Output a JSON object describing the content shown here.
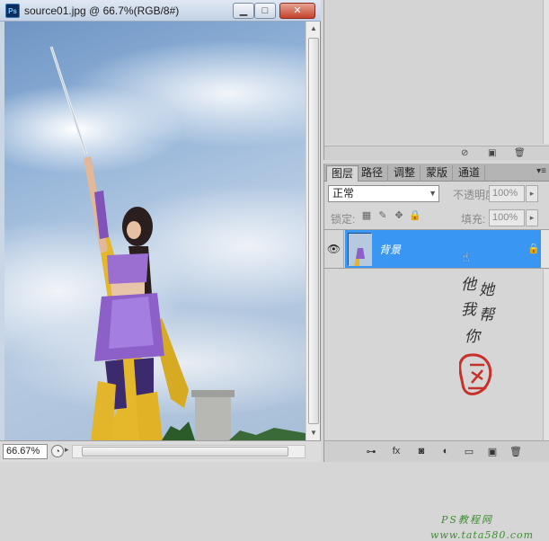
{
  "document": {
    "title": "source01.jpg @ 66.7%(RGB/8#)",
    "zoom": "66.67%",
    "ps_icon": "Ps"
  },
  "window_buttons": {
    "minimize": "▁",
    "maximize": "□",
    "close": "✕"
  },
  "top_panel": {
    "footer_icons": [
      "no-icon",
      "new-icon",
      "trash-icon"
    ]
  },
  "layers_panel": {
    "tabs": [
      "图层",
      "路径",
      "调整",
      "蒙版",
      "通道"
    ],
    "active_tab": "图层",
    "blend_mode": "正常",
    "opacity_label": "不透明度:",
    "opacity_value": "100%",
    "lock_label": "锁定:",
    "fill_label": "填充:",
    "fill_value": "100%",
    "layer": {
      "name": "背景",
      "visible_icon": "eye-icon",
      "locked": true
    }
  },
  "watermark": {
    "vertical_text": [
      "他",
      "她",
      "我",
      "帮",
      "你"
    ],
    "line1": "PS教程网",
    "line2": "www.tata580.com"
  },
  "colors": {
    "selection": "#3a96f3",
    "panel_bg": "#d6d6d6",
    "watermark_green": "#3f8e33",
    "seal_red": "#c8302a"
  }
}
